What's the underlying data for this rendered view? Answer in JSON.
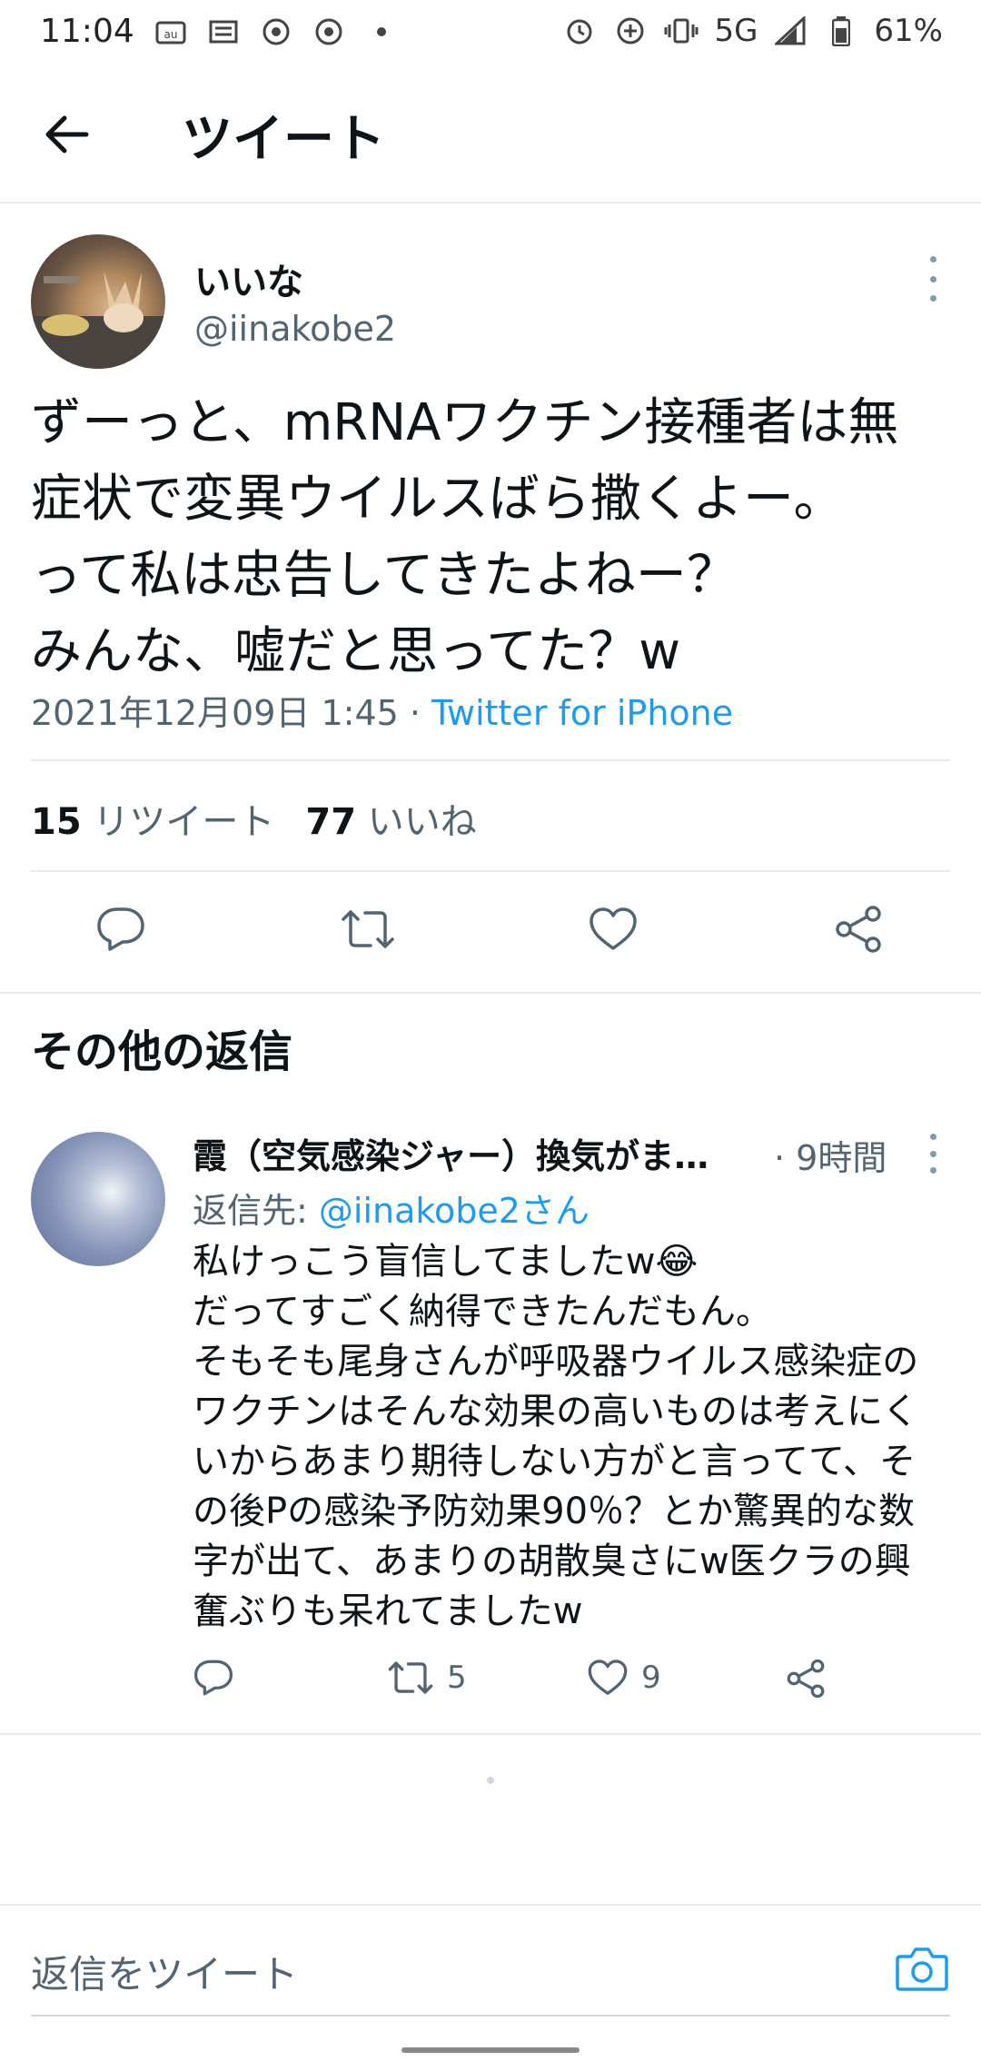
{
  "status_bar": {
    "time": "11:04",
    "network": "5G",
    "battery": "61%",
    "left_icons": [
      "au-icon",
      "news-icon",
      "chrome-icon",
      "chrome-icon",
      "dot-icon"
    ],
    "right_icons": [
      "alarm-icon",
      "data-saver-icon",
      "vibrate-icon",
      "signal-icon",
      "battery-icon"
    ]
  },
  "header": {
    "title": "ツイート"
  },
  "tweet": {
    "author_name": "いいな",
    "author_handle": "@iinakobe2",
    "text": "ずーっと、mRNAワクチン接種者は無\n症状で変異ウイルスばら撒くよー。\nって私は忠告してきたよねー？\nみんな、嘘だと思ってた？w",
    "timestamp": "2021年12月09日 1:45 · ",
    "source": "Twitter for iPhone",
    "retweet_count": "15",
    "retweet_label": "リツイート",
    "like_count": "77",
    "like_label": "いいね"
  },
  "more_replies_title": "その他の返信",
  "reply": {
    "name": "霞（空気感染ジャー）換気がま…",
    "time": "· 9時間",
    "reply_to_prefix": "返信先: ",
    "reply_to_mention": "@iinakobe2さん",
    "text": "私けっこう盲信してましたw😂\nだってすごく納得できたんだもん。\nそもそも尾身さんが呼吸器ウイルス感染症の\nワクチンはそんな効果の高いものは考えにく\nいからあまり期待しない方がと言ってて、そ\nの後Pの感染予防効果90％？とか驚異的な数\n字が出て、あまりの胡散臭さにw医クラの興\n奮ぶりも呆れてましたw",
    "retweet_count": "5",
    "like_count": "9"
  },
  "compose": {
    "placeholder": "返信をツイート"
  },
  "colors": {
    "accent": "#1d9bf0",
    "text": "#0f1419",
    "secondary": "#536471",
    "divider": "#e6ecf0"
  }
}
